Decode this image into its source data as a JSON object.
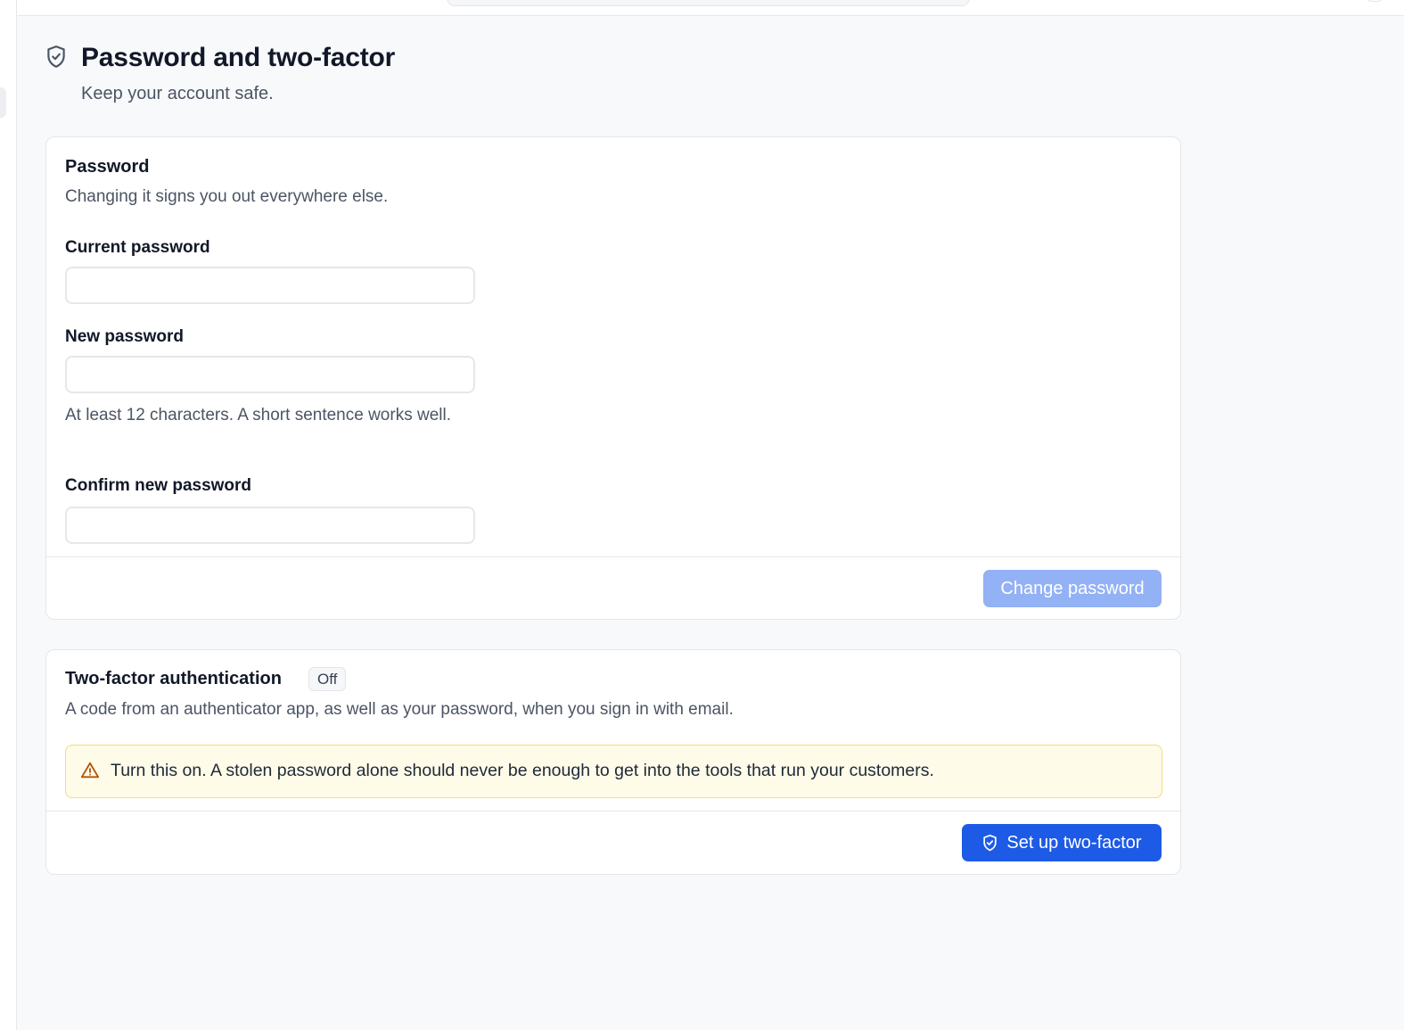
{
  "page": {
    "title": "Password and two-factor",
    "subtitle": "Keep your account safe."
  },
  "password_card": {
    "title": "Password",
    "description": "Changing it signs you out everywhere else.",
    "fields": {
      "current": {
        "label": "Current password",
        "value": ""
      },
      "new": {
        "label": "New password",
        "value": "",
        "hint": "At least 12 characters. A short sentence works well."
      },
      "confirm": {
        "label": "Confirm new password",
        "value": ""
      }
    },
    "submit_label": "Change password"
  },
  "two_factor_card": {
    "title": "Two-factor authentication",
    "status_badge": "Off",
    "description": "A code from an authenticator app, as well as your password, when you sign in with email.",
    "warning": "Turn this on. A stolen password alone should never be enough to get into the tools that run your customers.",
    "setup_label": "Set up two-factor"
  },
  "icons": {
    "page_icon": "shield-check-icon",
    "warning_icon": "warning-triangle-icon",
    "setup_icon": "shield-check-icon"
  },
  "colors": {
    "primary": "#1d5ae6",
    "primary_disabled": "#93b1f5",
    "warning_bg": "#fefbe8",
    "warning_border": "#f5dc79",
    "warning_icon": "#b45309"
  }
}
